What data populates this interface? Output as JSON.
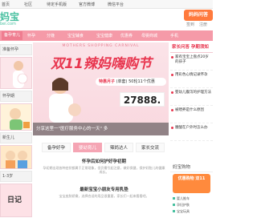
{
  "topbar": {
    "links": [
      "首页",
      "社区",
      "待定手机版",
      "官方微博",
      "微信平台"
    ]
  },
  "logo": {
    "brand": "妈宝",
    "domain": "bei.com"
  },
  "header": {
    "cta_label": "妈妈问答",
    "icon_labels": [
      "签到",
      "注册"
    ]
  },
  "nav": {
    "items": [
      "备孕育儿",
      "怀孕",
      "分娩",
      "宝宝辅食",
      "宝宝健康",
      "优惠券",
      "母婴商城",
      "手机"
    ],
    "active_index": 0
  },
  "left": {
    "tabs": [
      "准备怀孕",
      "怀孕期",
      "新生儿",
      "1-3岁"
    ],
    "diary_label": "日记"
  },
  "banner": {
    "eyebrow": "MOTHERS SHOPPING CARNIVAL",
    "title": "双11辣妈嗨购节",
    "subtitle_prefix": "特惠月子",
    "subtitle_tag": "(单套)",
    "subtitle_price": "50轮11个优惠",
    "price": "27888.",
    "caption": "分享这里一\"医疗服务中心的一天\" 多"
  },
  "news": {
    "heading": "家长问答 孕期须知",
    "items": [
      "家有宝宝上盘点20岁的孩子",
      "用彩色心情记录怀孕",
      "婴幼儿腹泻的护理方法",
      "被喂养是什么原因",
      "腰酸在户外时怎么办"
    ]
  },
  "tabs": {
    "items": [
      "备孕好孕",
      "婴幼育儿",
      "辣妈达人",
      "家长交流"
    ],
    "active_index": 1
  },
  "articles": [
    {
      "title": "怀孕后如何护好孕初期",
      "desc": "孕初期出现各种症状都属于正常现象，但仍需引起注意，做好保健，保护好胎儿的健康成长。"
    },
    {
      "title": "最新宝宝小朋友专用乳垫",
      "desc": "宝宝皮肤娇嫩，选择合适的用品很重要，家长们一起来看看吧。"
    }
  ],
  "rbox": {
    "heading": "妈宝购物",
    "card_text": "优惠购物 双11",
    "rows": [
      "婴儿推车",
      "孕妇护肤",
      "宝宝玩具"
    ]
  }
}
